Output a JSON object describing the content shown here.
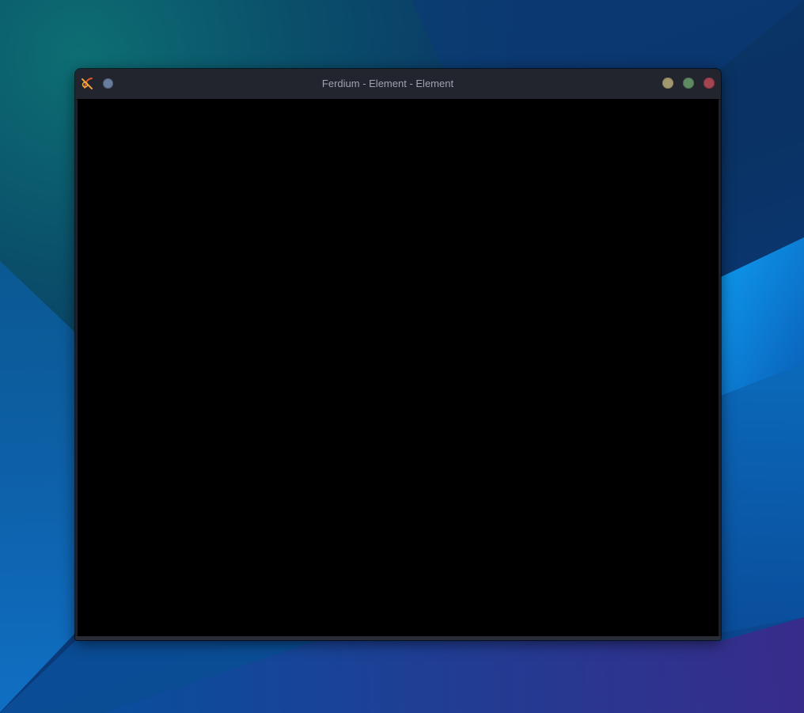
{
  "window": {
    "title": "Ferdium - Element - Element",
    "app_icon": "ferdium-logo-icon",
    "buttons": {
      "pin_icon": "pin-circle-icon",
      "minimize_icon": "minimize-circle-icon",
      "maximize_icon": "maximize-circle-icon",
      "close_icon": "close-circle-icon"
    }
  },
  "colors": {
    "titlebar": "#22242e",
    "content": "#000000",
    "title_text": "#9ea3b0",
    "minimize": "#a29870",
    "maximize": "#5f8a62",
    "close": "#a34550",
    "pin": "#6a7d9e"
  }
}
